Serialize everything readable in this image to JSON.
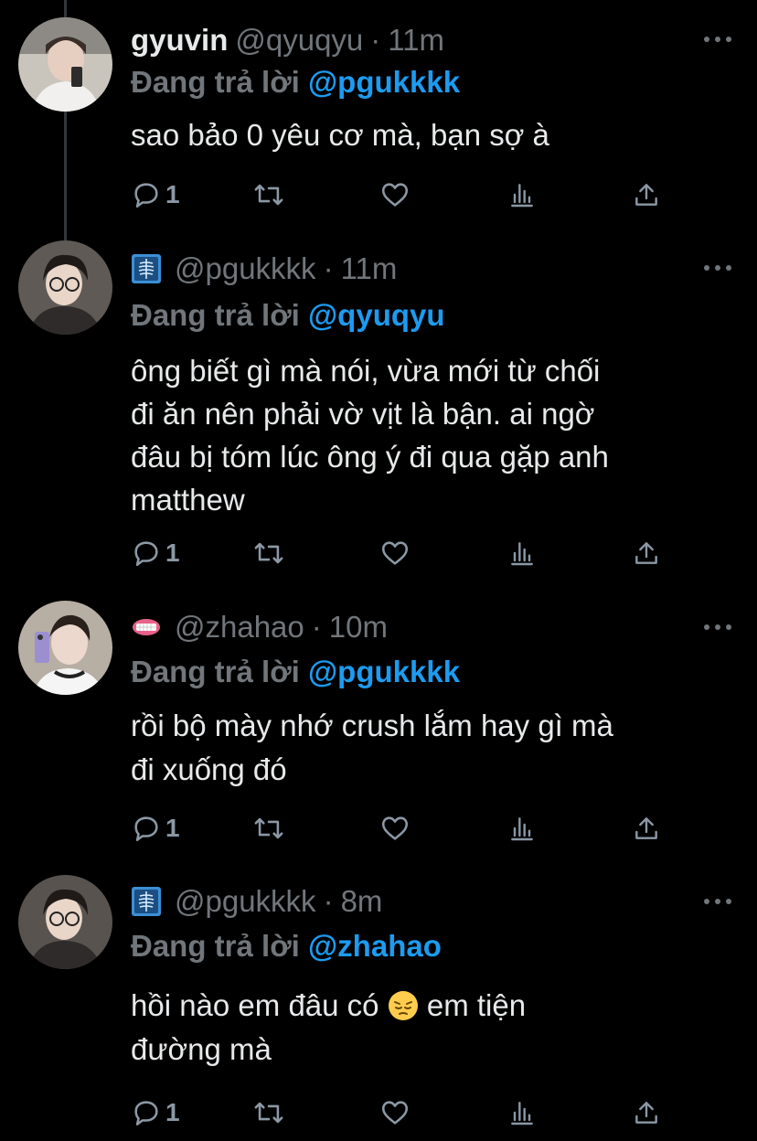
{
  "colors": {
    "background": "#000000",
    "text": "#e7e9ea",
    "muted": "#71767b",
    "mention": "#1d9bf0",
    "thread_line": "#333639"
  },
  "tweets": [
    {
      "name": "gyuvin",
      "handle": "@qyuqyu",
      "dot": "·",
      "time": "11m",
      "reply_prefix": "Đang trả lời",
      "reply_mention": "@pgukkkk",
      "text": "sao bảo 0 yêu cơ mà, bạn sợ à",
      "reply_count": "1"
    },
    {
      "name": "",
      "name_icon": "xray-emoji-icon",
      "handle": "@pgukkkk",
      "dot": "·",
      "time": "11m",
      "reply_prefix": "Đang trả lời",
      "reply_mention": "@qyuqyu",
      "text": "ông biết gì mà nói, vừa mới từ chối\nđi ăn nên phải vờ vịt là bận. ai ngờ\nđâu bị tóm lúc ông ý đi qua gặp anh\nmatthew",
      "reply_count": "1"
    },
    {
      "name": "",
      "name_icon": "teeth-emoji-icon",
      "handle": "@zhahao",
      "dot": "·",
      "time": "10m",
      "reply_prefix": "Đang trả lời",
      "reply_mention": "@pgukkkk",
      "text": "rồi bộ mày nhớ crush lắm hay gì mà\nđi xuống đó",
      "reply_count": "1"
    },
    {
      "name": "",
      "name_icon": "xray-emoji-icon",
      "handle": "@pgukkkk",
      "dot": "·",
      "time": "8m",
      "reply_prefix": "Đang trả lời",
      "reply_mention": "@zhahao",
      "text_part1": "hồi nào em đâu có ",
      "text_emoji": "pensive-face-emoji-icon",
      "text_part2": " em tiện\nđường mà",
      "reply_count": "1"
    }
  ]
}
